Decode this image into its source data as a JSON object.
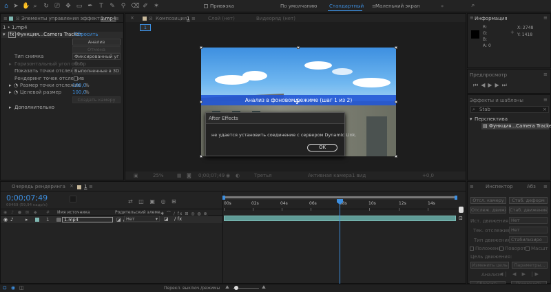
{
  "toolbar": {
    "snap_label": "Привязка",
    "workspaces": [
      "По умолчанию",
      "Стандартный",
      "Маленький экран"
    ],
    "active_workspace": "Стандартный"
  },
  "effects_panel": {
    "tab_title": "Элементы управления эффектами",
    "tab_file": "1.mp4",
    "breadcrumb": "1 • 1.mp4",
    "effect_name": "Функция...Camera Tracker",
    "reset": "Сбросить",
    "analyze_btn": "Анализ",
    "cancel_btn": "Отмена",
    "shot_type_label": "Тип снимка",
    "shot_type_value": "Фиксированный уг",
    "horiz_angle_label": "Горизонтальный угол обзор",
    "horiz_angle_value": "0.0",
    "show_points_label": "Показать точки отслежив",
    "show_points_value": "Выполненные в 3D",
    "render_points_label": "Рендеринг точек отслежив",
    "point_size_label": "Размер точки отслежив",
    "point_size_value": "100,0",
    "point_size_unit": "%",
    "target_size_label": "Целевой размер",
    "target_size_value": "100,0",
    "target_size_unit": "%",
    "create_camera_btn": "Создать камеру",
    "advanced_label": "Дополнительно"
  },
  "composition": {
    "tab_title": "Композиция",
    "tab_file": "1",
    "layer_tab": "Слой (нет)",
    "footage_tab": "Видеоряд (нет)",
    "subtab": "1",
    "zoom": "25%",
    "timecode": "0;00;07;49",
    "quality": "Третья",
    "active_camera": "Активная камера",
    "views": "1 вид",
    "offset": "+0,0"
  },
  "viewer": {
    "analysis_text": "Анализ в фоновом режиме (шаг 1 из 2)"
  },
  "dialog": {
    "title": "After Effects",
    "message": "не удается установить соединение с сервером Dynamic Link.",
    "ok": "OK"
  },
  "info_panel": {
    "title": "Информация",
    "r": "R:",
    "g": "G:",
    "b": "B:",
    "a": "A:",
    "r_val": "",
    "a_val": "0",
    "x": "X: 2748",
    "y": "Y: 1418"
  },
  "preview_panel": {
    "title": "Предпросмотр"
  },
  "effects_presets": {
    "title": "Эффекты и шаблоны",
    "search": "Stab",
    "category": "Перспектива",
    "item": "Функция...Camera Tracker"
  },
  "render_queue": {
    "tab": "Очередь рендеринга"
  },
  "timeline": {
    "tab_label": "1",
    "timecode": "0;00;07;49",
    "timecode_sub": "00469 (59,94 кадр/с)",
    "col_source": "Имя источника",
    "col_parent": "Родительский элемент",
    "layer_num": "1",
    "layer_name": "1.mp4",
    "parent_value": "Нет",
    "ruler": [
      "00s",
      "02s",
      "04s",
      "06s",
      "08s",
      "10s",
      "12s",
      "14s"
    ],
    "toggle_label": "Перекл. выключ./режимы"
  },
  "tracker_panel": {
    "tab1": "Инспектор",
    "tab2": "Абз",
    "btn_track_camera": "Отсл. камеру",
    "btn_warp": "Стаб. деформ",
    "btn_track_motion": "Отслеж. движен",
    "btn_stabilize": "Стаб. движение",
    "source_label": "Ист. движения",
    "source_value": "Нет",
    "current_track_label": "Тек. отслежив.",
    "current_track_value": "Нет",
    "track_type_label": "Тип движения",
    "track_type_value": "Стабилизиро",
    "position_label": "Положение",
    "rotation_label": "Поворот",
    "scale_label": "Масшт",
    "motion_target_label": "Цель движения:",
    "edit_target_btn": "Изменить цель",
    "options_btn": "Параметры...",
    "analyze_label": "Анализ:",
    "reset_btn": "Сбросить",
    "apply_btn": "Применить"
  },
  "colors": {
    "accent": "#3d8fe0",
    "track": "#5f9b96",
    "analysis_bar": "#2257d6"
  }
}
